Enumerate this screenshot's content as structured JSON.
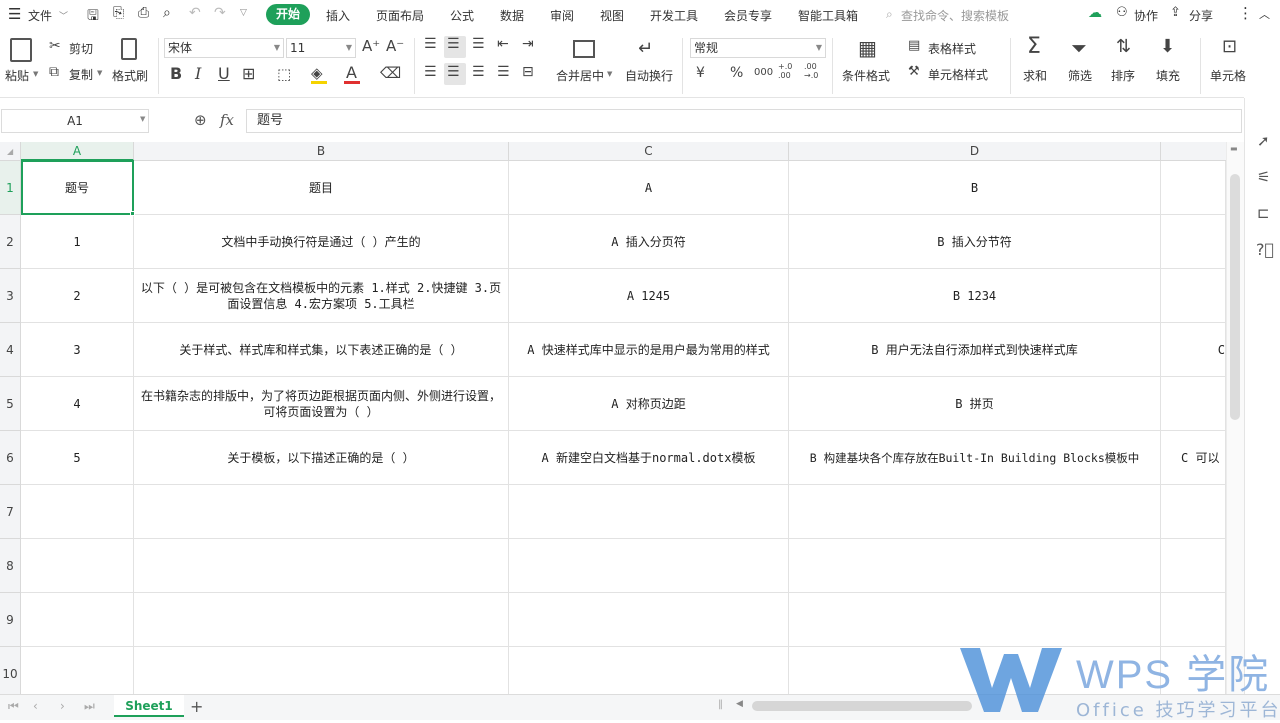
{
  "menu": {
    "file": "文件",
    "tabs": [
      "开始",
      "插入",
      "页面布局",
      "公式",
      "数据",
      "审阅",
      "视图",
      "开发工具",
      "会员专享",
      "智能工具箱"
    ],
    "search_placeholder": "查找命令、搜索模板",
    "collab": "协作",
    "share": "分享"
  },
  "ribbon": {
    "paste": "粘贴",
    "cut": "剪切",
    "copy": "复制",
    "format_painter": "格式刷",
    "font_name": "宋体",
    "font_size": "11",
    "merge_center": "合并居中",
    "auto_wrap": "自动换行",
    "number_format": "常规",
    "cond_format": "条件格式",
    "table_style": "表格样式",
    "cell_style": "单元格样式",
    "sum": "求和",
    "filter": "筛选",
    "sort": "排序",
    "fill": "填充",
    "cell": "单元格",
    "bold": "B",
    "italic": "I",
    "underline": "U",
    "font_color_letter": "A",
    "currency": "¥",
    "percent": "%",
    "thousands": "000",
    "inc_decimal": "+.0 .00",
    "dec_decimal": ".00 →.0"
  },
  "formula_bar": {
    "cell_ref": "A1",
    "fx": "fx",
    "content": "题号"
  },
  "columns": [
    "A",
    "B",
    "C",
    "D"
  ],
  "rows": [
    {
      "num": "1",
      "a": "题号",
      "b": "题目",
      "c": "A",
      "d": "B"
    },
    {
      "num": "2",
      "a": "1",
      "b": "文档中手动换行符是通过（ ）产生的",
      "c": "A 插入分页符",
      "d": "B 插入分节符"
    },
    {
      "num": "3",
      "a": "2",
      "b": "以下（ ）是可被包含在文档模板中的元素 1.样式 2.快捷键 3.页面设置信息 4.宏方案项 5.工具栏",
      "c": "A 1245",
      "d": "B 1234"
    },
    {
      "num": "4",
      "a": "3",
      "b": "关于样式、样式库和样式集，以下表述正确的是（ ）",
      "c": "A 快速样式库中显示的是用户最为常用的样式",
      "d": "B 用户无法自行添加样式到快速样式库",
      "e": "C"
    },
    {
      "num": "5",
      "a": "4",
      "b": "在书籍杂志的排版中，为了将页边距根据页面内侧、外侧进行设置，可将页面设置为（ ）",
      "c": "A 对称页边距",
      "d": "B 拼页"
    },
    {
      "num": "6",
      "a": "5",
      "b": "关于模板，以下描述正确的是（ ）",
      "c": "A 新建空白文档基于normal.dotx模板",
      "d": "B 构建基块各个库存放在Built-In Building Blocks模板中",
      "e": "C 可以"
    },
    {
      "num": "7"
    },
    {
      "num": "8"
    },
    {
      "num": "9"
    },
    {
      "num": "10"
    }
  ],
  "sheet": {
    "tab": "Sheet1",
    "add": "+"
  },
  "watermark": {
    "title": "WPS 学院",
    "subtitle": "Office 技巧学习平台"
  },
  "colors": {
    "accent": "#1ea05a",
    "watermark": "#4a8fd8"
  }
}
